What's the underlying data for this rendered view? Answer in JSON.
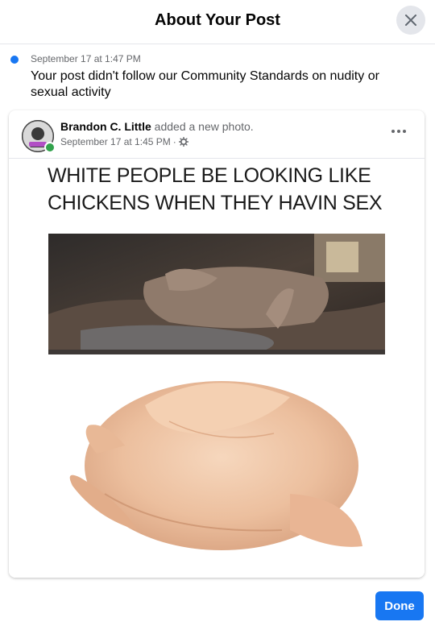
{
  "dialog": {
    "title": "About Your Post",
    "close_icon": "close-icon"
  },
  "notice": {
    "date": "September 17 at 1:47 PM",
    "message": "Your post didn't follow our Community Standards on nudity or sexual activity",
    "indicator_color": "#1877f2"
  },
  "post": {
    "author": "Brandon C. Little",
    "action": "added a new photo.",
    "timestamp": "September 17 at 1:45 PM",
    "separator": "·",
    "privacy_icon": "gear-icon",
    "more_icon": "more-options-icon",
    "online": true,
    "image_caption": "WHITE PEOPLE BE LOOKING LIKE CHICKENS WHEN THEY HAVIN SEX",
    "image_panels": [
      "dark-photo",
      "raw-chicken-photo"
    ]
  },
  "footer": {
    "done_label": "Done"
  },
  "colors": {
    "accent": "#1877f2",
    "online": "#31a24c",
    "secondary_text": "#65676b"
  }
}
